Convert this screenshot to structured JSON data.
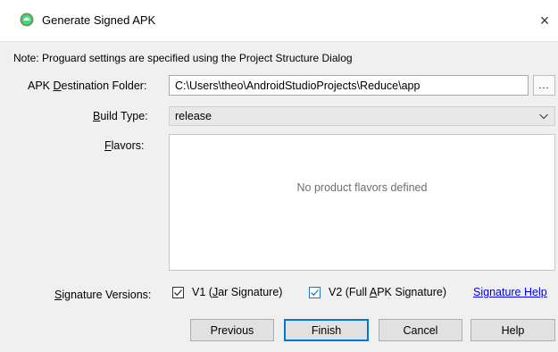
{
  "window": {
    "title": "Generate Signed APK",
    "close_glyph": "×"
  },
  "note": "Note: Proguard settings are specified using the Project Structure Dialog",
  "destination": {
    "label_pre": "APK ",
    "label_ul": "D",
    "label_post": "estination Folder:",
    "value": "C:\\Users\\theo\\AndroidStudioProjects\\Reduce\\app",
    "browse_label": "..."
  },
  "build_type": {
    "label_ul": "B",
    "label_post": "uild Type:",
    "selected": "release"
  },
  "flavors": {
    "label_ul": "F",
    "label_post": "lavors:",
    "empty_text": "No product flavors defined"
  },
  "signature": {
    "label_ul": "S",
    "label_post": "ignature Versions:",
    "v1": {
      "pre": "V1 (",
      "ul": "J",
      "post": "ar Signature)",
      "checked": true
    },
    "v2": {
      "pre": "V2 (Full ",
      "ul": "A",
      "post": "PK Signature)",
      "checked": true
    },
    "help_link": "Signature Help"
  },
  "buttons": {
    "previous": "Previous",
    "finish": "Finish",
    "cancel": "Cancel",
    "help": "Help"
  },
  "colors": {
    "accent": "#0078d7",
    "link": "#0000ee",
    "android_green": "#3ddc84"
  },
  "icons": {
    "app": "android-studio-icon",
    "close": "close-icon",
    "dropdown": "chevron-down-icon",
    "check": "checkmark-icon"
  }
}
